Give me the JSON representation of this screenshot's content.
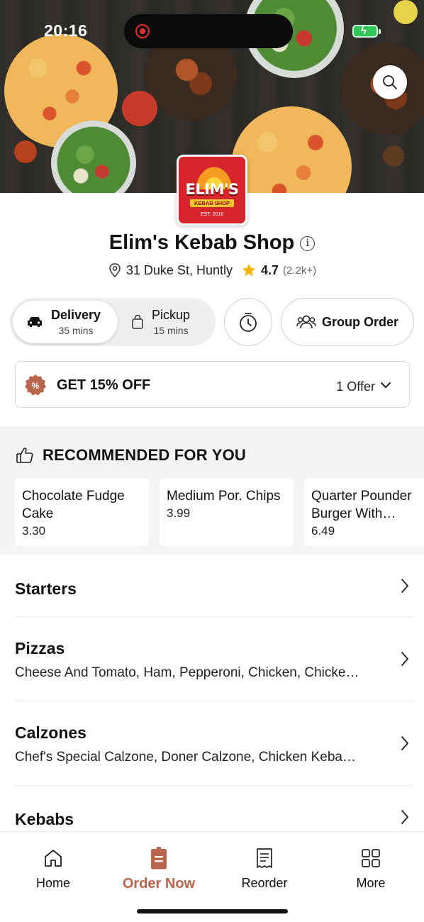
{
  "status_bar": {
    "time": "20:16"
  },
  "hero": {
    "search_icon": "search-icon"
  },
  "logo": {
    "name": "ELIM'S",
    "subtitle": "KEBAB SHOP",
    "est": "EST. 2016"
  },
  "shop": {
    "name": "Elim's Kebab Shop",
    "address": "31 Duke St, Huntly",
    "rating": "4.7",
    "rating_count": "(2.2k+)"
  },
  "order_mode": {
    "delivery": {
      "label": "Delivery",
      "time": "35 mins",
      "selected": true
    },
    "pickup": {
      "label": "Pickup",
      "time": "15 mins",
      "selected": false
    },
    "group_order_label": "Group Order"
  },
  "offer": {
    "title": "GET 15% OFF",
    "count": "1 Offer"
  },
  "recommended": {
    "heading": "RECOMMENDED FOR YOU",
    "items": [
      {
        "name": "Chocolate Fudge Cake",
        "price": "3.30"
      },
      {
        "name": "Medium Por. Chips",
        "price": "3.99"
      },
      {
        "name": "Quarter Pounder Burger With Cheese",
        "price": "6.49"
      }
    ]
  },
  "categories": [
    {
      "title": "Starters",
      "description": ""
    },
    {
      "title": "Pizzas",
      "description": "Cheese And Tomato, Ham, Pepperoni, Chicken, Chicke…"
    },
    {
      "title": "Calzones",
      "description": "Chef's Special Calzone, Doner Calzone, Chicken Keba…"
    },
    {
      "title": "Kebabs",
      "description": ""
    }
  ],
  "bottom_nav": [
    {
      "label": "Home",
      "icon": "home-icon",
      "active": false
    },
    {
      "label": "Order Now",
      "icon": "order-icon",
      "active": true
    },
    {
      "label": "Reorder",
      "icon": "receipt-icon",
      "active": false
    },
    {
      "label": "More",
      "icon": "grid-icon",
      "active": false
    }
  ],
  "colors": {
    "accent": "#b9654c",
    "logo_red": "#d6262b",
    "star": "#f5b400"
  }
}
